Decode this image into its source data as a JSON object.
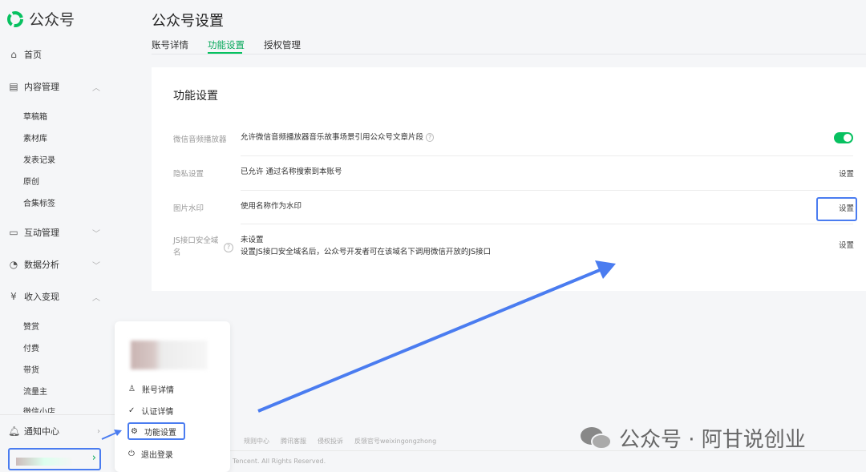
{
  "app": {
    "name": "公众号"
  },
  "sidebar": {
    "home": "首页",
    "content": {
      "label": "内容管理",
      "items": [
        "草稿箱",
        "素材库",
        "发表记录",
        "原创",
        "合集标签"
      ]
    },
    "interaction": "互动管理",
    "analytics": "数据分析",
    "monetize": {
      "label": "收入变现",
      "items": [
        "赞赏",
        "付费",
        "带货",
        "流量主",
        "微信小店"
      ]
    },
    "notifications": "通知中心"
  },
  "header": {
    "title": "公众号设置",
    "tabs": [
      "账号详情",
      "功能设置",
      "授权管理"
    ]
  },
  "card": {
    "title": "功能设置",
    "rows": [
      {
        "label": "微信音频播放器",
        "value": "允许微信音频播放器音乐故事场景引用公众号文章片段"
      },
      {
        "label": "隐私设置",
        "value": "已允许 通过名称搜索到本账号",
        "action": "设置"
      },
      {
        "label": "图片水印",
        "value": "使用名称作为水印",
        "action": "设置"
      },
      {
        "label": "JS接口安全域名",
        "value": "未设置",
        "desc": "设置JS接口安全域名后，公众号开发者可在该域名下调用微信开放的JS接口",
        "action": "设置"
      }
    ]
  },
  "popup": {
    "items": [
      "账号详情",
      "认证详情",
      "功能设置",
      "退出登录"
    ]
  },
  "footer": {
    "links": [
      "规则中心",
      "腾讯客服",
      "侵权投诉",
      "反馈官号weixingongzhong"
    ],
    "copyright": "Tencent. All Rights Reserved."
  },
  "watermark": "公众号 · 阿甘说创业",
  "colors": {
    "accent": "#07c160",
    "highlight": "#4a7cf0"
  }
}
